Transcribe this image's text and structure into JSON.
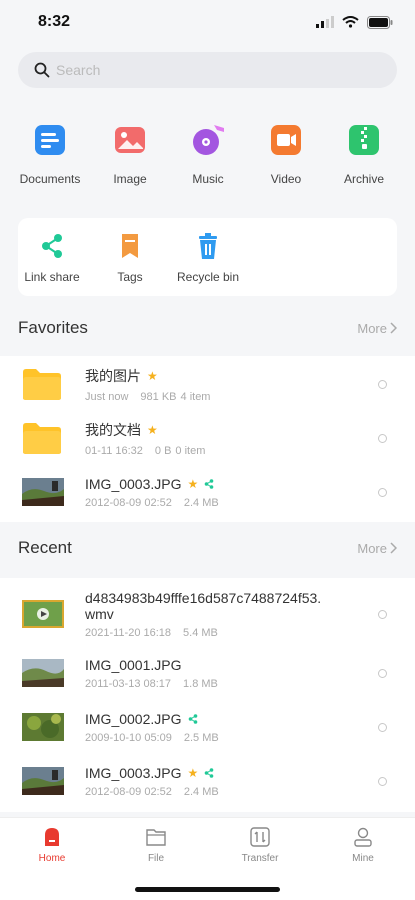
{
  "status": {
    "time": "8:32"
  },
  "search": {
    "placeholder": "Search"
  },
  "categories": [
    {
      "label": "Documents",
      "icon": "documents-icon",
      "color": "#2f8cf0"
    },
    {
      "label": "Image",
      "icon": "image-icon",
      "color": "#f26b6b"
    },
    {
      "label": "Music",
      "icon": "music-icon",
      "color": "#a356e0"
    },
    {
      "label": "Video",
      "icon": "video-icon",
      "color": "#f47a30"
    },
    {
      "label": "Archive",
      "icon": "archive-icon",
      "color": "#2ec46e"
    }
  ],
  "tools": [
    {
      "label": "Link share",
      "icon": "link-share-icon",
      "color": "#20c997"
    },
    {
      "label": "Tags",
      "icon": "tag-icon",
      "color": "#f39a40"
    },
    {
      "label": "Recycle bin",
      "icon": "trash-icon",
      "color": "#2f9bf0"
    }
  ],
  "favorites": {
    "title": "Favorites",
    "more": "More",
    "items": [
      {
        "name": "我的图片",
        "time": "Just now",
        "size": "981 KB",
        "count": "4 item",
        "type": "folder",
        "starred": true,
        "shared": false
      },
      {
        "name": "我的文档",
        "time": "01-11 16:32",
        "size": "0 B",
        "count": "0 item",
        "type": "folder",
        "starred": true,
        "shared": false
      },
      {
        "name": "IMG_0003.JPG",
        "time": "2012-08-09 02:52",
        "size": "2.4 MB",
        "count": "",
        "type": "photo",
        "starred": true,
        "shared": true
      }
    ]
  },
  "recent": {
    "title": "Recent",
    "more": "More",
    "items": [
      {
        "name": "d4834983b49fffe16d587c7488724f53.",
        "name2": "wmv",
        "time": "2021-11-20 16:18",
        "size": "5.4 MB",
        "type": "video",
        "starred": false,
        "shared": false
      },
      {
        "name": "IMG_0001.JPG",
        "time": "2011-03-13 08:17",
        "size": "1.8 MB",
        "type": "photo",
        "starred": false,
        "shared": false
      },
      {
        "name": "IMG_0002.JPG",
        "time": "2009-10-10 05:09",
        "size": "2.5 MB",
        "type": "photo",
        "starred": false,
        "shared": true
      },
      {
        "name": "IMG_0003.JPG",
        "time": "2012-08-09 02:52",
        "size": "2.4 MB",
        "type": "photo",
        "starred": true,
        "shared": true
      }
    ]
  },
  "tabs": [
    {
      "label": "Home",
      "icon": "home-icon",
      "active": true
    },
    {
      "label": "File",
      "icon": "file-folder-icon",
      "active": false
    },
    {
      "label": "Transfer",
      "icon": "transfer-icon",
      "active": false
    },
    {
      "label": "Mine",
      "icon": "user-icon",
      "active": false
    }
  ],
  "colors": {
    "accent": "#e83a2f",
    "star": "#f5b11e",
    "share": "#20c997",
    "folder": "#ffc329"
  }
}
